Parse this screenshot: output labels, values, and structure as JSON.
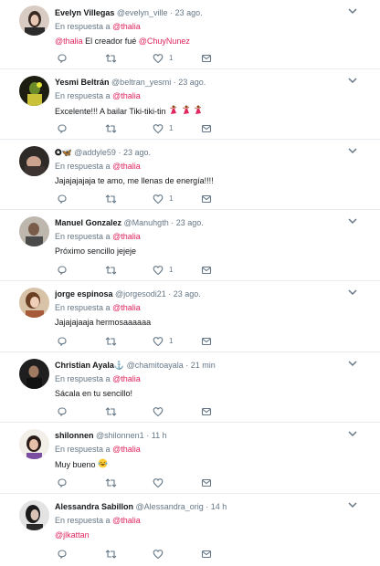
{
  "reply_prefix": "En respuesta a",
  "tweets": [
    {
      "name": "Evelyn Villegas",
      "handle": "@evelyn_ville",
      "time": "23 ago.",
      "reply_to": "@thalia",
      "text": "El creador fué ",
      "text_mention_pre": "@thalia",
      "text_mention_post": "@ChuyNunez",
      "like_count": "1"
    },
    {
      "name": "Yesmi Beltrán",
      "handle": "@beltran_yesmi",
      "time": "23 ago.",
      "reply_to": "@thalia",
      "text": "Excelente!!! A bailar Tiki-tiki-tin",
      "emojis": "dancer-emoji x3",
      "like_count": "1"
    },
    {
      "name": "✪🦋",
      "handle": "@addyle59",
      "time": "23 ago.",
      "reply_to": "@thalia",
      "text": "Jajajajajaja te amo, me llenas de energía!!!!",
      "like_count": "1"
    },
    {
      "name": "Manuel Gonzalez",
      "handle": "@Manuhgth",
      "time": "23 ago.",
      "reply_to": "@thalia",
      "text": "Próximo sencillo jejeje",
      "like_count": "1"
    },
    {
      "name": "jorge espinosa",
      "handle": "@jorgesodi21",
      "time": "23 ago.",
      "reply_to": "@thalia",
      "text": "Jajajajaaja hermosaaaaaa",
      "like_count": "1"
    },
    {
      "name": "Christian Ayala⚓",
      "handle": "@chamitoayala",
      "time": "21 min",
      "reply_to": "@thalia",
      "text": "Sácala en tu sencillo!",
      "like_count": ""
    },
    {
      "name": "shilonnen",
      "handle": "@shilonnen1",
      "time": "11 h",
      "reply_to": "@thalia",
      "text": "Muy bueno",
      "emojis": "tears-of-joy-emoji",
      "like_count": ""
    },
    {
      "name": "Alessandra Sabillon",
      "handle": "@Alessandra_orig",
      "time": "14 h",
      "reply_to": "@thalia",
      "text_mention_only": "@jlkattan",
      "like_count": ""
    }
  ],
  "colors": {
    "mention": "#e0245e",
    "muted": "#657786",
    "divider": "#e6ecf0"
  }
}
